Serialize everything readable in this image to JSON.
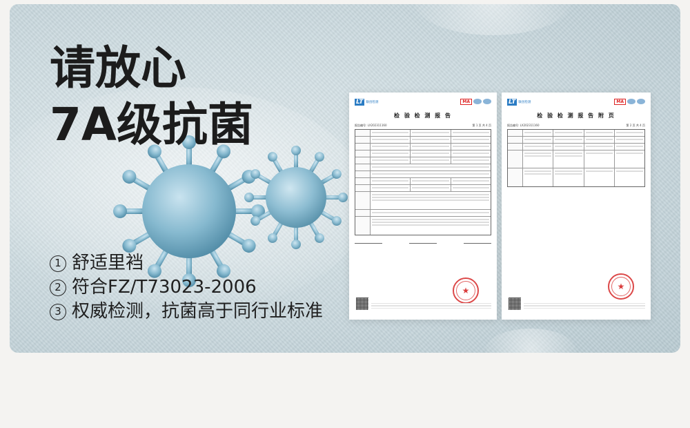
{
  "headline": {
    "line1": "请放心",
    "line2": "7A级抗菌"
  },
  "features": [
    {
      "num": "1",
      "text": "舒适里裆"
    },
    {
      "num": "2",
      "text": "符合FZ/T73023-2006"
    },
    {
      "num": "3",
      "text": "权威检测，抗菌高于同行业标准"
    }
  ],
  "doc1": {
    "logo_mark": "LT",
    "logo_text": "联创检测",
    "badge": "MA",
    "title": "检 验 检 测 报 告",
    "report_no": "报告编号: LX202311160",
    "page": "第 1 页 共 4 页"
  },
  "doc2": {
    "logo_mark": "LT",
    "logo_text": "联创检测",
    "badge": "MA",
    "title": "检 验 检 测 报 告 附 页",
    "report_no": "报告编号: LX202311160",
    "page": "第 2 页 共 4 页"
  },
  "colors": {
    "banner": "#cfdde2",
    "virus": "#7fb2c8",
    "stamp": "#d62828",
    "logo": "#2b7cc4"
  }
}
